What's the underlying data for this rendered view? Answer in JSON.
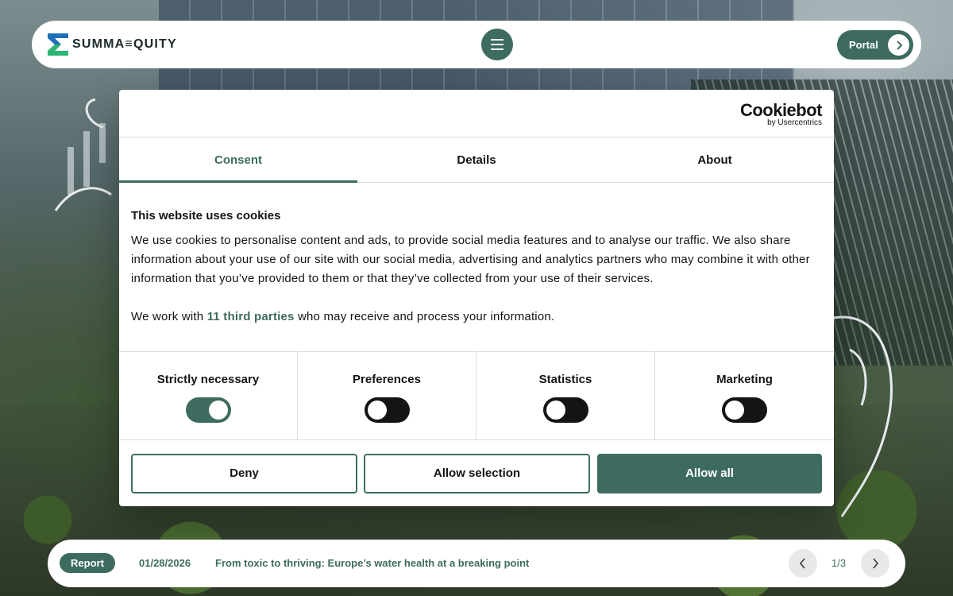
{
  "header": {
    "logo_text": "SUMMA≡QUITY",
    "portal_label": "Portal",
    "menu_icon": "hamburger-icon",
    "portal_icon": "chevron-right-icon"
  },
  "cookie_dialog": {
    "brand": "Cookiebot",
    "brand_sub": "by Usercentrics",
    "tabs": [
      {
        "label": "Consent",
        "active": true
      },
      {
        "label": "Details",
        "active": false
      },
      {
        "label": "About",
        "active": false
      }
    ],
    "heading": "This website uses cookies",
    "body": "We use cookies to personalise content and ads, to provide social media features and to analyse our traffic. We also share information about your use of our site with our social media, advertising and analytics partners who may combine it with other information that you’ve provided to them or that they’ve collected from your use of their services.",
    "partners_prefix": "We work with",
    "partners_link": "11 third parties",
    "partners_suffix": "who may receive and process your information.",
    "toggles": [
      {
        "label": "Strictly necessary",
        "checked": true
      },
      {
        "label": "Preferences",
        "checked": false
      },
      {
        "label": "Statistics",
        "checked": false
      },
      {
        "label": "Marketing",
        "checked": false
      }
    ],
    "buttons": {
      "deny": "Deny",
      "allow_selection": "Allow selection",
      "allow_all": "Allow all"
    }
  },
  "news_bar": {
    "badge": "Report",
    "date": "01/28/2026",
    "title": "From toxic to thriving: Europe’s water health at a breaking point",
    "pager": "1/3",
    "prev_icon": "chevron-left-icon",
    "next_icon": "chevron-right-icon"
  },
  "colors": {
    "brand": "#3d6b60",
    "text": "#141414",
    "logo_blue": "#1e6fb8",
    "logo_green": "#2bb673"
  }
}
